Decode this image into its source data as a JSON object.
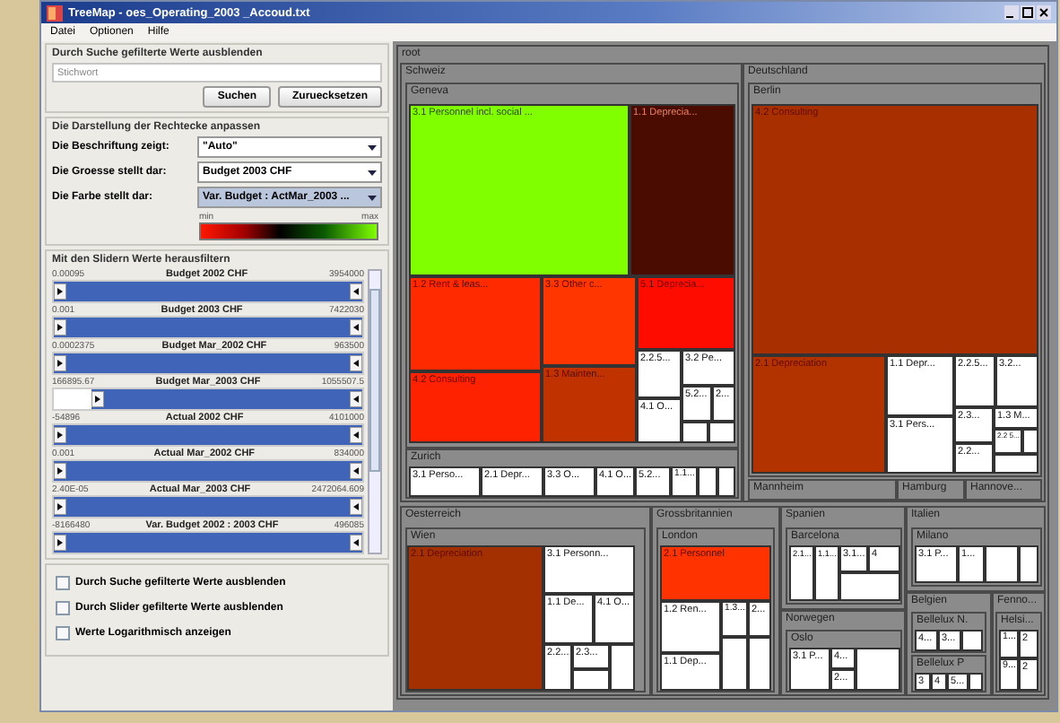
{
  "window": {
    "title": "TreeMap - oes_Operating_2003 _Accoud.txt"
  },
  "menu": [
    "Datei",
    "Optionen",
    "Hilfe"
  ],
  "search": {
    "title": "Durch Suche gefilterte Werte ausblenden",
    "placeholder": "Stichwort",
    "buttons": [
      "Suchen",
      "Zuruecksetzen"
    ]
  },
  "display": {
    "title": "Die Darstellung der Rechtecke anpassen",
    "rows": [
      {
        "label": "Die Beschriftung zeigt:",
        "value": "\"Auto\"",
        "highlighted": false
      },
      {
        "label": "Die Groesse stellt dar:",
        "value": "Budget 2003 CHF",
        "highlighted": false
      },
      {
        "label": "Die Farbe stellt dar:",
        "value": "Var. Budget : ActMar_2003 ...",
        "highlighted": true
      }
    ],
    "scale": {
      "min": "min",
      "max": "max"
    }
  },
  "sliders": {
    "title": "Mit den Slidern Werte herausfiltern",
    "items": [
      {
        "min": "0.00095",
        "name": "Budget 2002 CHF",
        "max": "3954000",
        "level": 1
      },
      {
        "min": "0.001",
        "name": "Budget 2003 CHF",
        "max": "7422030",
        "level": 1
      },
      {
        "min": "0.0002375",
        "name": "Budget Mar_2002 CHF",
        "max": "963500",
        "level": 1
      },
      {
        "min": "166895.67",
        "name": "Budget Mar_2003 CHF",
        "max": "1055507.5",
        "level": 0.88
      },
      {
        "min": "-54896",
        "name": "Actual 2002 CHF",
        "max": "4101000",
        "level": 1
      },
      {
        "min": "0.001",
        "name": "Actual Mar_2002 CHF",
        "max": "834000",
        "level": 1
      },
      {
        "min": "2.40E-05",
        "name": "Actual Mar_2003 CHF",
        "max": "2472064.609",
        "level": 1
      },
      {
        "min": "-8166480",
        "name": "Var. Budget 2002 : 2003 CHF",
        "max": "496085",
        "level": 1
      }
    ]
  },
  "options": [
    {
      "label": "Durch Suche gefilterte Werte ausblenden",
      "checked": false
    },
    {
      "label": "Durch Slider gefilterte Werte ausblenden",
      "checked": false
    },
    {
      "label": "Werte Logarithmisch anzeigen",
      "checked": false
    }
  ],
  "treemap": {
    "kind": "group",
    "label": "root",
    "children": [
      {
        "kind": "group",
        "label": "Schweiz",
        "children": [
          {
            "kind": "group",
            "label": "Geneva",
            "children": [
              {
                "kind": "tile",
                "label": "3.1 Personnel incl. social ...",
                "color": "#80ff00"
              },
              {
                "kind": "tile",
                "label": "1.1 Deprecia...",
                "color": "#4a0c00"
              },
              {
                "kind": "tile",
                "label": "1.2 Rent & leas...",
                "color": "#ff2a00"
              },
              {
                "kind": "tile",
                "label": "3.3 Other c...",
                "color": "#ff3600"
              },
              {
                "kind": "tile",
                "label": "5.1 Deprecia...",
                "color": "#ff0c00"
              },
              {
                "kind": "tile",
                "label": "4.2 Consulting",
                "color": "#ff2200"
              },
              {
                "kind": "tile",
                "label": "1.3 Mainten...",
                "color": "#c03200"
              },
              {
                "kind": "tile",
                "label": "2.2.5...",
                "color": "#ffffff"
              },
              {
                "kind": "tile",
                "label": "3.2 Pe...",
                "color": "#ffffff"
              },
              {
                "kind": "tile",
                "label": "4.1 O...",
                "color": "#ffffff"
              },
              {
                "kind": "tile",
                "label": "5.2...",
                "color": "#ffffff"
              },
              {
                "kind": "tile",
                "label": "2...",
                "color": "#ffffff"
              },
              {
                "kind": "tile",
                "color": "#ffffff"
              },
              {
                "kind": "tile",
                "color": "#ffffff"
              }
            ]
          },
          {
            "kind": "group",
            "label": "Zurich",
            "children": [
              {
                "kind": "tile",
                "label": "3.1 Perso...",
                "color": "#ffffff"
              },
              {
                "kind": "tile",
                "label": "2.1 Depr...",
                "color": "#ffffff"
              },
              {
                "kind": "tile",
                "label": "3.3 O...",
                "color": "#ffffff"
              },
              {
                "kind": "tile",
                "label": "4.1 O...",
                "color": "#ffffff"
              },
              {
                "kind": "tile",
                "label": "5.2...",
                "color": "#ffffff"
              },
              {
                "kind": "tile",
                "label": "1.1...",
                "color": "#ffffff"
              },
              {
                "kind": "tile",
                "color": "#ffffff"
              },
              {
                "kind": "tile",
                "color": "#ffffff"
              }
            ]
          }
        ]
      },
      {
        "kind": "group",
        "label": "Deutschland",
        "children": [
          {
            "kind": "group",
            "label": "Berlin",
            "children": [
              {
                "kind": "tile",
                "label": "4.2 Consulting",
                "color": "#a83000"
              },
              {
                "kind": "tile",
                "label": "2.1 Depreciation",
                "color": "#b33300"
              },
              {
                "kind": "tile",
                "label": "1.1 Depr...",
                "color": "#ffffff"
              },
              {
                "kind": "tile",
                "label": "3.1 Pers...",
                "color": "#ffffff"
              },
              {
                "kind": "tile",
                "label": "2.2.5...",
                "color": "#ffffff"
              },
              {
                "kind": "tile",
                "label": "3.2...",
                "color": "#ffffff"
              },
              {
                "kind": "tile",
                "label": "2.3...",
                "color": "#ffffff"
              },
              {
                "kind": "tile",
                "label": "1.3 M...",
                "color": "#ffffff"
              },
              {
                "kind": "tile",
                "label": "2.2...",
                "color": "#ffffff"
              },
              {
                "kind": "tile",
                "label": "2.2 5...",
                "color": "#ffffff"
              },
              {
                "kind": "tile",
                "color": "#ffffff"
              },
              {
                "kind": "tile",
                "color": "#ffffff"
              }
            ]
          },
          {
            "kind": "group",
            "label": "Mannheim"
          },
          {
            "kind": "group",
            "label": "Hamburg"
          },
          {
            "kind": "group",
            "label": "Hannove..."
          }
        ]
      },
      {
        "kind": "group",
        "label": "Oesterreich",
        "children": [
          {
            "kind": "group",
            "label": "Wien",
            "children": [
              {
                "kind": "tile",
                "label": "2.1 Depreciation",
                "color": "#a33000"
              },
              {
                "kind": "tile",
                "label": "3.1 Personn...",
                "color": "#ffffff"
              },
              {
                "kind": "tile",
                "label": "1.1 De...",
                "color": "#ffffff"
              },
              {
                "kind": "tile",
                "label": "4.1 O...",
                "color": "#ffffff"
              },
              {
                "kind": "tile",
                "label": "2.2...",
                "color": "#ffffff"
              },
              {
                "kind": "tile",
                "label": "2.3...",
                "color": "#ffffff"
              },
              {
                "kind": "tile",
                "color": "#ffffff"
              },
              {
                "kind": "tile",
                "color": "#ffffff"
              }
            ]
          }
        ]
      },
      {
        "kind": "group",
        "label": "Grossbritannien",
        "children": [
          {
            "kind": "group",
            "label": "London",
            "children": [
              {
                "kind": "tile",
                "label": "2.1 Personnel",
                "color": "#ff3300"
              },
              {
                "kind": "tile",
                "label": "1.2 Ren...",
                "color": "#ffffff"
              },
              {
                "kind": "tile",
                "label": "1.3...",
                "color": "#ffffff"
              },
              {
                "kind": "tile",
                "label": "2...",
                "color": "#ffffff"
              },
              {
                "kind": "tile",
                "label": "1.1 Dep...",
                "color": "#ffffff"
              },
              {
                "kind": "tile",
                "color": "#ffffff"
              },
              {
                "kind": "tile",
                "color": "#ffffff"
              }
            ]
          }
        ]
      },
      {
        "kind": "group",
        "label": "Spanien",
        "children": [
          {
            "kind": "group",
            "label": "Barcelona",
            "children": [
              {
                "kind": "tile",
                "label": "2.1...",
                "color": "#ffffff"
              },
              {
                "kind": "tile",
                "label": "1.1...",
                "color": "#ffffff"
              },
              {
                "kind": "tile",
                "label": "3.1...",
                "color": "#ffffff"
              },
              {
                "kind": "tile",
                "label": "4",
                "color": "#ffffff"
              },
              {
                "kind": "tile",
                "color": "#ffffff"
              }
            ]
          }
        ]
      },
      {
        "kind": "group",
        "label": "Norwegen",
        "children": [
          {
            "kind": "group",
            "label": "Oslo",
            "children": [
              {
                "kind": "tile",
                "label": "3.1 P...",
                "color": "#ffffff"
              },
              {
                "kind": "tile",
                "label": "4...",
                "color": "#ffffff"
              },
              {
                "kind": "tile",
                "label": "2...",
                "color": "#ffffff"
              },
              {
                "kind": "tile",
                "color": "#ffffff"
              }
            ]
          }
        ]
      },
      {
        "kind": "group",
        "label": "Italien",
        "children": [
          {
            "kind": "group",
            "label": "Milano",
            "children": [
              {
                "kind": "tile",
                "label": "3.1 P...",
                "color": "#ffffff"
              },
              {
                "kind": "tile",
                "label": "1...",
                "color": "#ffffff"
              },
              {
                "kind": "tile",
                "color": "#ffffff"
              },
              {
                "kind": "tile",
                "color": "#ffffff"
              }
            ]
          }
        ]
      },
      {
        "kind": "group",
        "label": "Belgien",
        "children": [
          {
            "kind": "group",
            "label": "Bellelux N.",
            "children": [
              {
                "kind": "tile",
                "label": "4...",
                "color": "#ffffff"
              },
              {
                "kind": "tile",
                "label": "3...",
                "color": "#ffffff"
              },
              {
                "kind": "tile",
                "color": "#ffffff"
              }
            ]
          },
          {
            "kind": "group",
            "label": "Bellelux P",
            "children": [
              {
                "kind": "tile",
                "label": "3",
                "color": "#ffffff"
              },
              {
                "kind": "tile",
                "label": "4",
                "color": "#ffffff"
              },
              {
                "kind": "tile",
                "label": "5...",
                "color": "#ffffff"
              },
              {
                "kind": "tile",
                "color": "#ffffff"
              }
            ]
          }
        ]
      },
      {
        "kind": "group",
        "label": "Fenno...",
        "children": [
          {
            "kind": "group",
            "label": "Helsi...",
            "children": [
              {
                "kind": "tile",
                "label": "1...",
                "color": "#ffffff"
              },
              {
                "kind": "tile",
                "label": "2",
                "color": "#ffffff"
              },
              {
                "kind": "tile",
                "label": "9...",
                "color": "#ffffff"
              },
              {
                "kind": "tile",
                "label": "2",
                "color": "#ffffff"
              }
            ]
          }
        ]
      }
    ]
  }
}
